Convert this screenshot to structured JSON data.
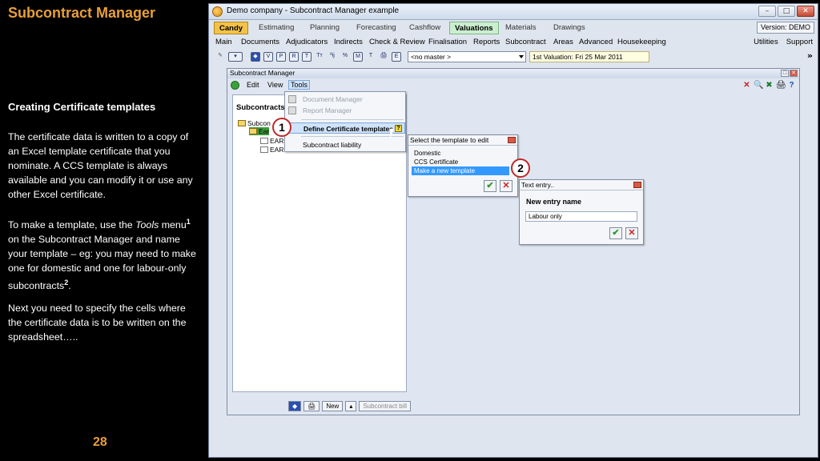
{
  "slide": {
    "title": "Subcontract Manager",
    "heading": "Creating Certificate templates",
    "para1": "The certificate data is written to a copy of an Excel template certificate that you nominate.  A CCS template is always available and you can modify it or use any other Excel certificate.",
    "para2_a": "To make a template, use the ",
    "para2_tools": "Tools",
    "para2_b": " menu",
    "para2_sup1": "1",
    "para2_c": " on the Subcontract Manager and name your template – eg: you may need to make  one for domestic and one for labour-only subcontracts",
    "para2_sup2": "2",
    "para2_d": ".",
    "para3": "Next you need to specify the cells where the certificate data is to be written on the spreadsheet…..",
    "page_number": "28"
  },
  "window": {
    "title": "Demo company - Subcontract Manager example",
    "controls": [
      "–",
      "□",
      "✕"
    ]
  },
  "tabs": {
    "items": [
      "Candy",
      "Estimating",
      "Planning",
      "Forecasting",
      "Cashflow",
      "Valuations",
      "Materials",
      "Drawings"
    ],
    "active": "Valuations",
    "version": "Version: DEMO"
  },
  "menubar": {
    "items": [
      "Main",
      "Documents",
      "Adjudicators",
      "Indirects",
      "Check & Review",
      "Finalisation",
      "Reports",
      "Subcontract",
      "Areas",
      "Advanced",
      "Housekeeping"
    ],
    "right": [
      "Utilities",
      "Support"
    ]
  },
  "toolbar": {
    "icon_labels": [
      "V",
      "P",
      "R",
      "T",
      "Tт",
      "ªij",
      "%",
      "M",
      "T",
      "🖨",
      "E"
    ],
    "master_select": "<no master >",
    "valuation": "1st Valuation: Fri 25 Mar 2011",
    "more": "»"
  },
  "child": {
    "title": "Subcontract Manager",
    "menu": [
      "Edit",
      "View",
      "Tools"
    ],
    "right_icons": [
      "✕",
      "🔍",
      "✖",
      "🖨",
      "?"
    ],
    "tree_header": "Subcontracts",
    "tree_nodes": [
      "Subcon",
      "Ear",
      "EAR",
      "EAR"
    ],
    "bottom": {
      "new_label": "New",
      "subcontract_bill": "Subcontract bill"
    }
  },
  "dropdown": {
    "items": [
      {
        "label": "Document Manager",
        "state": "disabled"
      },
      {
        "label": "Report Manager",
        "state": "disabled"
      },
      {
        "label": "Define Certificate templates",
        "state": "highlighted"
      },
      {
        "label": "Subcontract liability",
        "state": "normal"
      }
    ],
    "help": "?"
  },
  "template_popup": {
    "title": "Select the template to edit",
    "options": [
      "Domestic",
      "CCS Certificate",
      "Make a new template"
    ],
    "selected": "Make a new template"
  },
  "text_entry": {
    "title": "Text entry..",
    "label": "New entry name",
    "value": "Labour only"
  },
  "callouts": [
    "1",
    "2"
  ]
}
